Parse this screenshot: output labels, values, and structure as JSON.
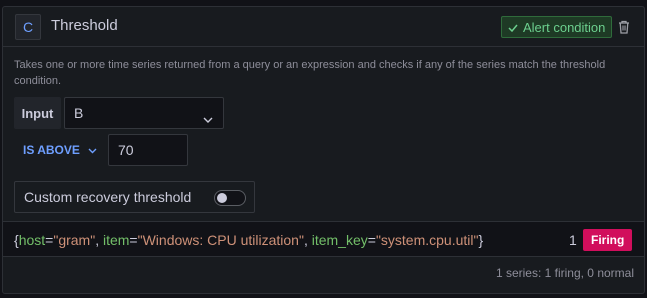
{
  "header": {
    "ref_id": "C",
    "title": "Threshold",
    "alert_badge_label": "Alert condition",
    "alert_badge_icon": "check-icon",
    "delete_icon": "trash-icon"
  },
  "description": "Takes one or more time series returned from a query or an expression and checks if any of the series match the threshold condition.",
  "form": {
    "input_label": "Input",
    "input_value": "B",
    "evaluator_label": "IS ABOVE",
    "threshold_value": "70",
    "recovery_label": "Custom recovery threshold",
    "recovery_enabled": false
  },
  "series": {
    "open_brace": "{",
    "close_brace": "}",
    "labels": [
      {
        "key": "host",
        "value": "\"gram\""
      },
      {
        "key": "item",
        "value": "\"Windows: CPU utilization\""
      },
      {
        "key": "item_key",
        "value": "\"system.cpu.util\""
      }
    ],
    "value": "1",
    "state": "Firing"
  },
  "summary": "1 series: 1 firing, 0 normal",
  "colors": {
    "accent": "#6e9fff",
    "firing": "#d10e5c",
    "success": "#6ccf8e"
  }
}
